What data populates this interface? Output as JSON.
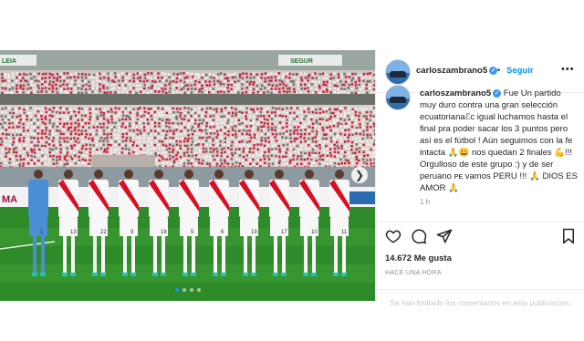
{
  "post": {
    "username": "carloszambrano5",
    "follow_label": "Seguir",
    "separator": "•",
    "more_label": "•••",
    "caption_parts": [
      "Fue Un partido muy duro contra una gran selección ecuatorianaℰc igual luchamos hasta el final pra poder sacar los 3 puntos pero así es el fútbol ! Aún seguimos con la fe intacta ",
      "🙏",
      "😀",
      " nos quedan 2 finales ",
      "💪",
      "!!! Orgulloso de este grupo :) y de ser peruano ᴘᴇ vamos PERU !!! ",
      "🙏",
      " DIOS ES AMOR ",
      "🙏"
    ],
    "time_ago": "1 h",
    "likes_text": "14.672 Me gusta",
    "date_text": "HACE UNA HORA",
    "comments_limited": "Se han limitado los comentarios en esta publicación."
  },
  "photo": {
    "banner_left": "LEIA",
    "banner_right": "SEGUR",
    "board_text": "MA",
    "next_icon": "chevron-right-icon",
    "carousel_total": 4,
    "carousel_active": 1,
    "player_numbers": [
      "1",
      "13",
      "22",
      "9",
      "18",
      "5",
      "6",
      "19",
      "17",
      "10",
      "11"
    ]
  },
  "colors": {
    "link_blue": "#0095f6",
    "verified_blue": "#3897f0",
    "peru_red": "#d91023",
    "keeper_blue": "#4a8fd6",
    "pitch_green": "#2f8a2a"
  },
  "icons": {
    "like": "heart-icon",
    "comment": "comment-icon",
    "share": "share-icon",
    "save": "bookmark-icon",
    "verified": "verified-badge-icon"
  }
}
